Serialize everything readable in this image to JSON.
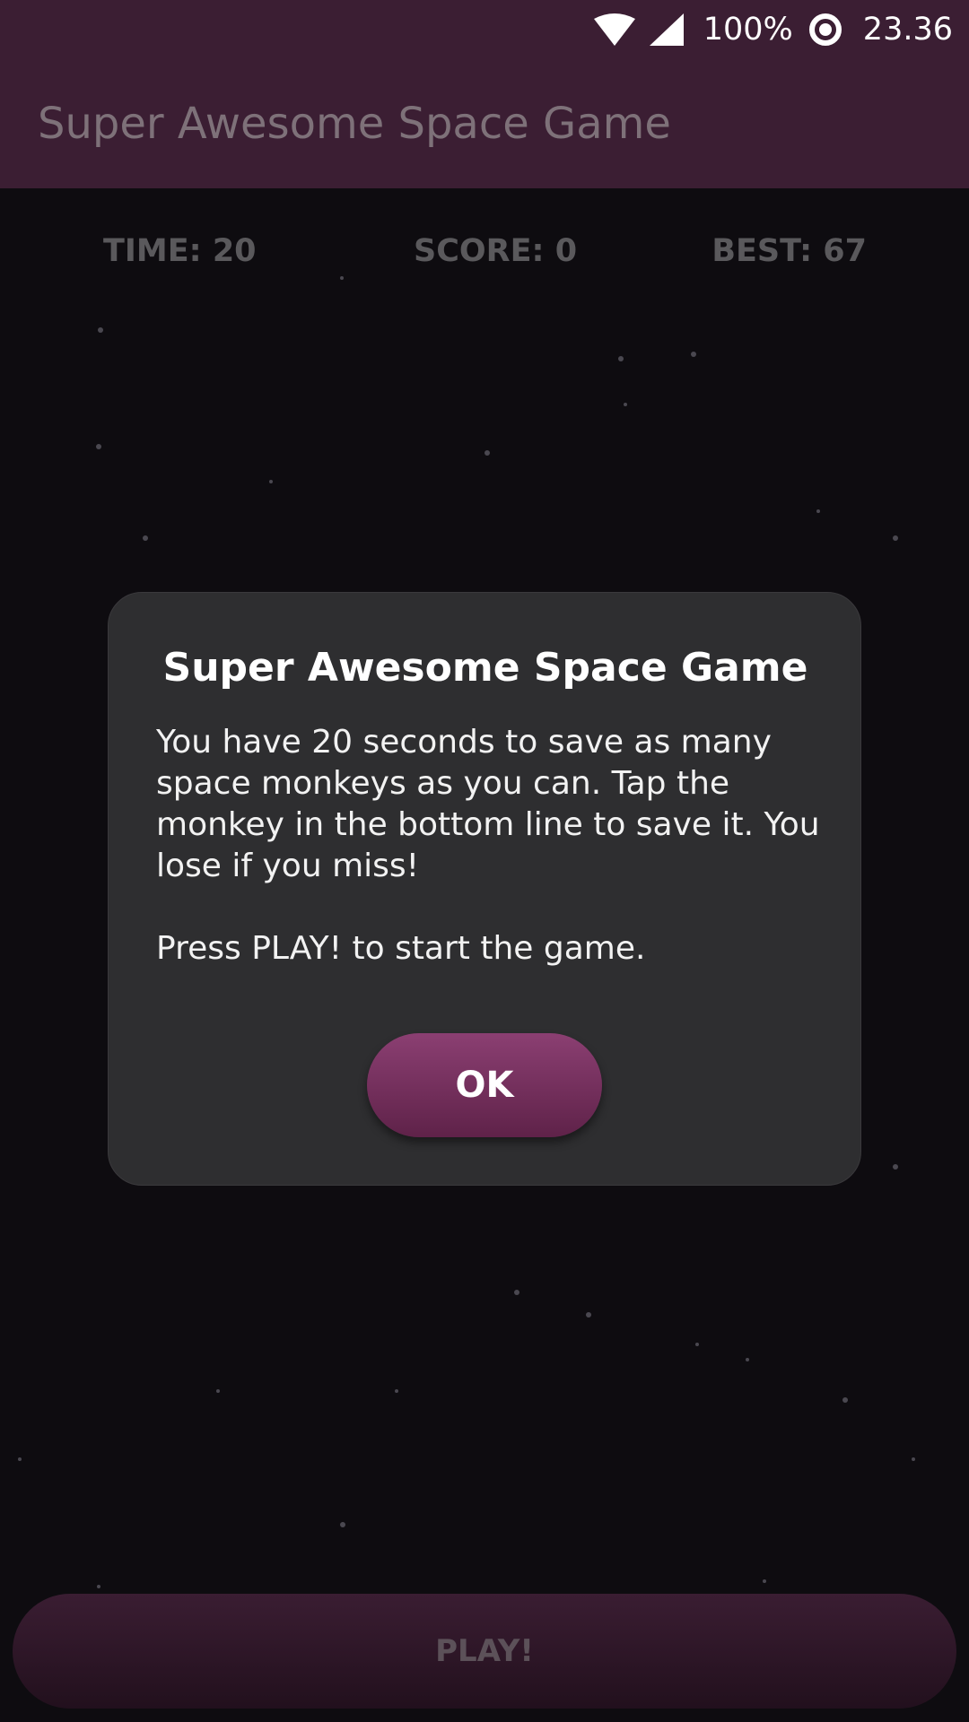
{
  "status_bar": {
    "battery": "100%",
    "time": "23.36",
    "icons": [
      "wifi-icon",
      "cell-signal-icon",
      "data-saver-icon"
    ]
  },
  "app_bar": {
    "title": "Super Awesome Space Game"
  },
  "stats": {
    "time": "TIME: 20",
    "score": "SCORE: 0",
    "best": "BEST: 67"
  },
  "dialog": {
    "title": "Super Awesome Space Game",
    "body_line1": "You have 20 seconds to save as many space monkeys as you can. Tap the monkey in the bottom line to save it. You lose if you miss!",
    "body_line2": "Press PLAY! to start the game.",
    "ok_label": "OK"
  },
  "play_button": {
    "label": "PLAY!"
  },
  "colors": {
    "app_bar": "#3b1e33",
    "background": "#0e0c10",
    "dialog": "#2e2e30",
    "accent": "#8b3f72"
  }
}
